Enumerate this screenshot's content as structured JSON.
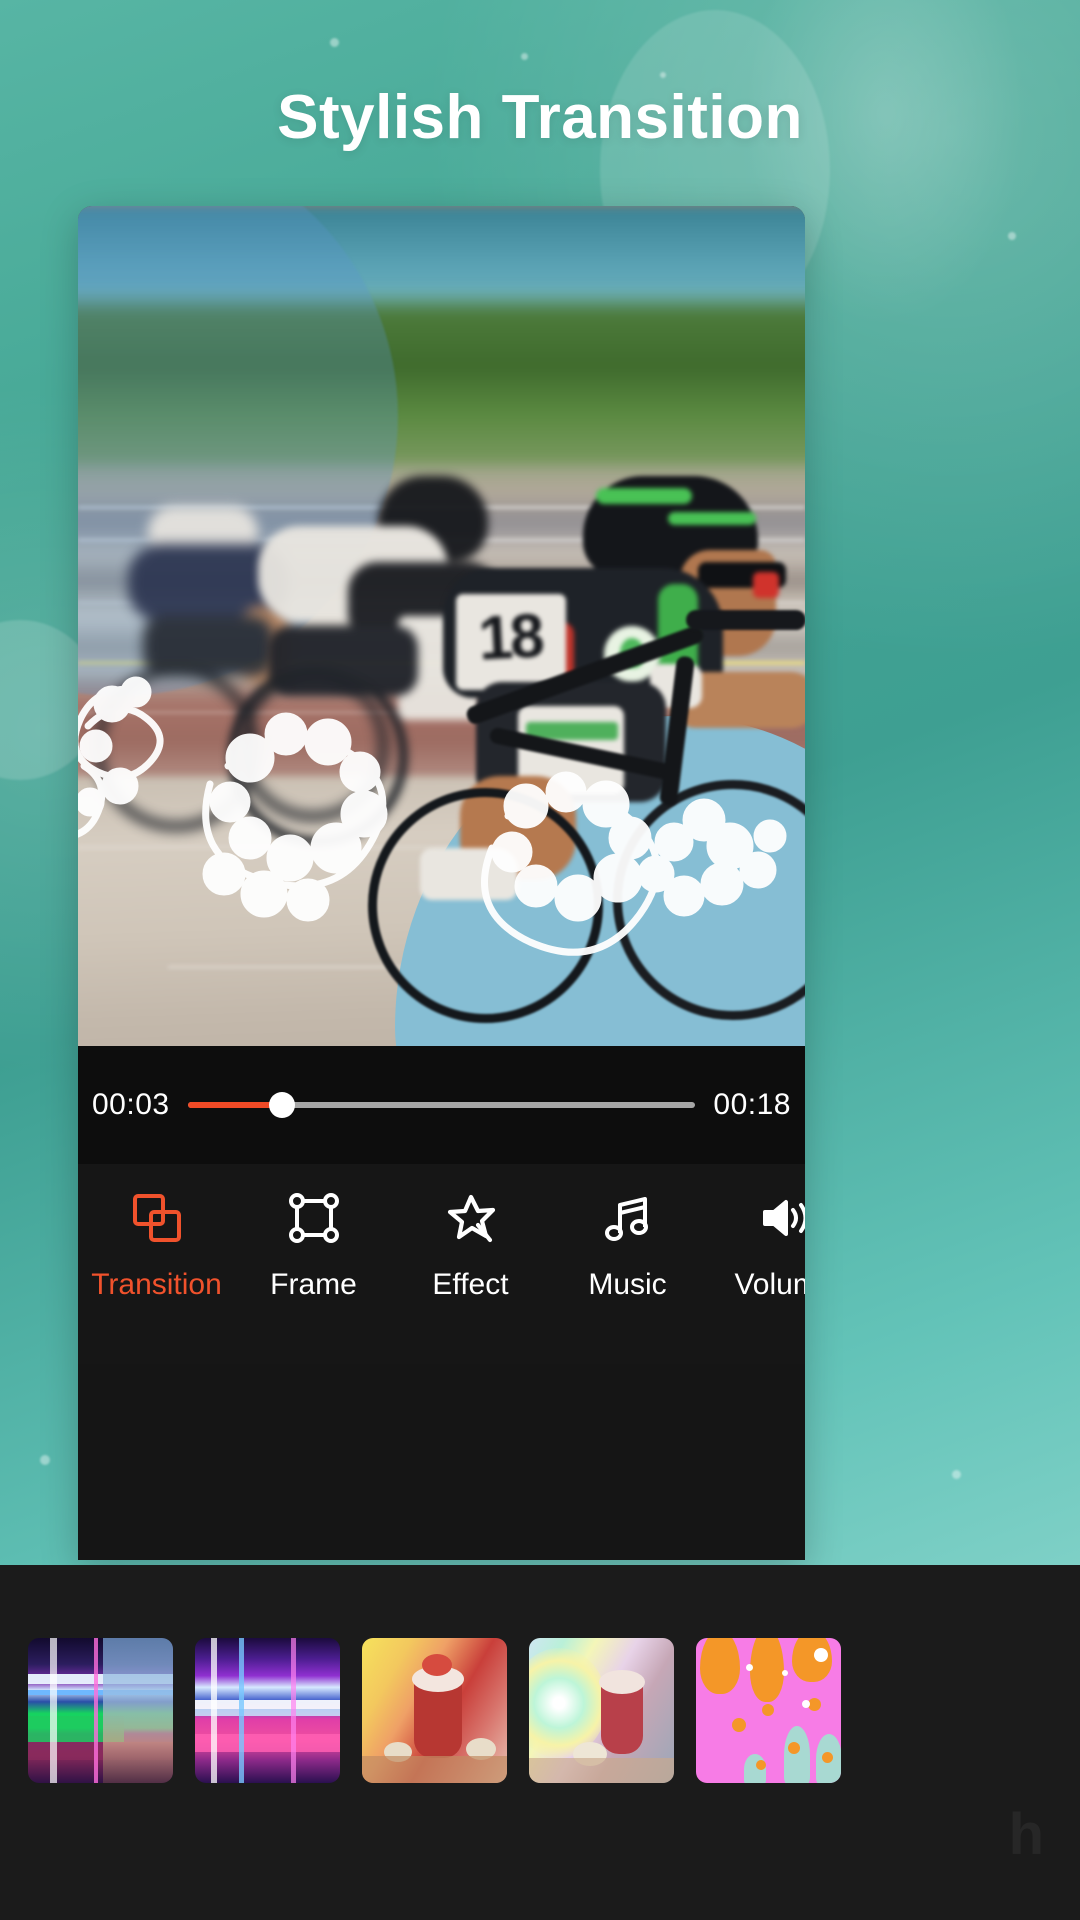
{
  "headline": {
    "text": "Stylish Transition"
  },
  "colors": {
    "accent": "#f0522c",
    "panel_bg": "#161616",
    "seek_bg": "#0d0d0d",
    "strip_bg": "#1b1b1b",
    "bg_teal_start": "#57b5a4",
    "bg_teal_end": "#9fe0d8",
    "progress_fill": "#f04a26",
    "progress_track": "#a6a6a6",
    "tab_label": "#ffffff"
  },
  "player": {
    "current_time": "00:03",
    "total_time": "00:18",
    "progress_percent": 18.5,
    "knob_name": "seek-handle"
  },
  "tabs": [
    {
      "label": "Transition",
      "icon": "transition-icon",
      "active": true
    },
    {
      "label": "Frame",
      "icon": "frame-icon",
      "active": false
    },
    {
      "label": "Effect",
      "icon": "effect-star-icon",
      "active": false
    },
    {
      "label": "Music",
      "icon": "music-note-icon",
      "active": false
    },
    {
      "label": "Volume",
      "icon": "volume-icon",
      "active": false
    }
  ],
  "transitions": [
    {
      "name": "glitch-rgb",
      "style": "t-glitch1"
    },
    {
      "name": "glitch-neon",
      "style": "t-glitch2"
    },
    {
      "name": "warm-flash",
      "style": "t-warm"
    },
    {
      "name": "prism-light",
      "style": "t-prism"
    },
    {
      "name": "pop-splash",
      "style": "t-pop"
    }
  ],
  "watermark": {
    "text": "h"
  }
}
